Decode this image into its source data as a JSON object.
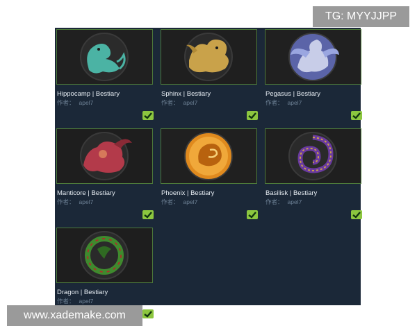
{
  "items": [
    {
      "title": "Hippocamp | Bestiary",
      "author_label": "作者：",
      "author": "apel7",
      "creature": "hippocamp-icon",
      "color": "#4bb3a4",
      "subscribed": true
    },
    {
      "title": "Sphinx | Bestiary",
      "author_label": "作者：",
      "author": "apel7",
      "creature": "sphinx-icon",
      "color": "#c9a24a",
      "subscribed": true
    },
    {
      "title": "Pegasus | Bestiary",
      "author_label": "作者：",
      "author": "apel7",
      "creature": "pegasus-icon",
      "color": "#7d8fd6",
      "subscribed": true
    },
    {
      "title": "Manticore | Bestiary",
      "author_label": "作者：",
      "author": "apel7",
      "creature": "manticore-icon",
      "color": "#b33a4a",
      "subscribed": true
    },
    {
      "title": "Phoenix | Bestiary",
      "author_label": "作者：",
      "author": "apel7",
      "creature": "phoenix-icon",
      "color": "#e08a1e",
      "subscribed": true
    },
    {
      "title": "Basilisk | Bestiary",
      "author_label": "作者：",
      "author": "apel7",
      "creature": "basilisk-icon",
      "color": "#6a3aa0",
      "subscribed": true
    },
    {
      "title": "Dragon | Bestiary",
      "author_label": "作者：",
      "author": "apel7",
      "creature": "dragon-icon",
      "color": "#3f8a2e",
      "subscribed": true
    }
  ],
  "watermarks": {
    "tg": "TG: MYYJJPP",
    "site": "www.xademake.com"
  },
  "colors": {
    "panel": "#1b2838",
    "check": "#8cc63f",
    "title": "#e6ecf2",
    "author": "#6e8296",
    "badge": "#9a9a9a"
  }
}
